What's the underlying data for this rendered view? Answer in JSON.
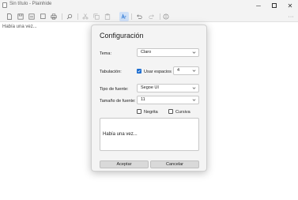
{
  "window": {
    "title": "Sin título - Plainhide",
    "minimize_glyph": "─",
    "close_glyph": "✕"
  },
  "toolbar": {
    "icons": [
      "new-file-icon",
      "save-icon",
      "save-as-icon",
      "print-icon",
      "find-icon",
      "cut-icon",
      "copy-icon",
      "paste-icon",
      "font-settings-icon",
      "undo-icon",
      "redo-icon",
      "info-icon",
      "more-icon"
    ],
    "more_glyph": "···"
  },
  "editor": {
    "text": "Había una vez..."
  },
  "dialog": {
    "title": "Configuración",
    "theme_label": "Tema:",
    "theme_value": "Claro",
    "tab_label": "Tabulación:",
    "use_spaces_label": "Usar espacios",
    "use_spaces_checked": true,
    "tab_size_value": "4",
    "font_type_label": "Tipo de fuente:",
    "font_type_value": "Segoe UI",
    "font_size_label": "Tamaño de fuente:",
    "font_size_value": "11",
    "bold_label": "Negrita",
    "bold_checked": false,
    "italic_label": "Cursiva",
    "italic_checked": false,
    "preview_text": "Había una vez...",
    "accept_label": "Aceptar",
    "cancel_label": "Cancelar"
  },
  "colors": {
    "accent": "#1f6fd1",
    "chrome": "#f3f3f3",
    "dialog_bg": "#f4f4f4"
  }
}
